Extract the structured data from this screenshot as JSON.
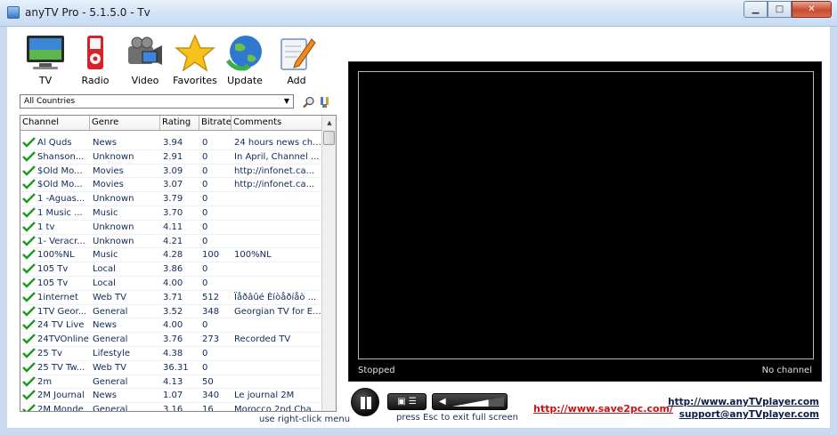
{
  "window": {
    "title": "anyTV Pro - 5.1.5.0 - Tv"
  },
  "toolbar": [
    {
      "id": "tv",
      "label": "TV",
      "icon": "tv-icon"
    },
    {
      "id": "radio",
      "label": "Radio",
      "icon": "radio-icon"
    },
    {
      "id": "video",
      "label": "Video",
      "icon": "video-camera-icon"
    },
    {
      "id": "favorites",
      "label": "Favorites",
      "icon": "star-icon"
    },
    {
      "id": "update",
      "label": "Update",
      "icon": "globe-update-icon"
    },
    {
      "id": "add",
      "label": "Add",
      "icon": "add-edit-icon"
    }
  ],
  "country_filter": {
    "selected": "All Countries"
  },
  "table": {
    "columns": [
      "Channel",
      "Genre",
      "Rating",
      "Bitrate",
      "Comments"
    ],
    "rows": [
      [
        "Al Quds",
        "News",
        "3.94",
        "0",
        "24 hours news ch..."
      ],
      [
        "Shanson...",
        "Unknown",
        "2.91",
        "0",
        "In April, Channel ..."
      ],
      [
        "$Old Mo...",
        "Movies",
        "3.09",
        "0",
        "http://infonet.ca..."
      ],
      [
        "$Old Mo...",
        "Movies",
        "3.07",
        "0",
        "http://infonet.ca..."
      ],
      [
        "1 -Aguas...",
        "Unknown",
        "3.79",
        "0",
        ""
      ],
      [
        "1 Music ...",
        "Music",
        "3.70",
        "0",
        ""
      ],
      [
        "1 tv",
        "Unknown",
        "4.11",
        "0",
        ""
      ],
      [
        "1- Veracr...",
        "Unknown",
        "4.21",
        "0",
        ""
      ],
      [
        "100%NL",
        "Music",
        "4.28",
        "100",
        "100%NL"
      ],
      [
        "105 Tv",
        "Local",
        "3.86",
        "0",
        ""
      ],
      [
        "105 Tv",
        "Local",
        "4.00",
        "0",
        ""
      ],
      [
        "1internet",
        "Web TV",
        "3.71",
        "512",
        "Ïåðâûé Èíòåðíåò ..."
      ],
      [
        "1TV Geor...",
        "General",
        "3.52",
        "348",
        "Georgian TV for E..."
      ],
      [
        "24 TV Live",
        "News",
        "4.00",
        "0",
        ""
      ],
      [
        "24TVOnline",
        "General",
        "3.76",
        "273",
        "Recorded TV"
      ],
      [
        "25 Tv",
        "Lifestyle",
        "4.38",
        "0",
        ""
      ],
      [
        "25 TV Tw...",
        "Web TV",
        "36.31",
        "0",
        ""
      ],
      [
        "2m",
        "General",
        "4.13",
        "50",
        ""
      ],
      [
        "2M Journal",
        "News",
        "1.07",
        "340",
        "Le journal 2M"
      ],
      [
        "2M Monde",
        "General",
        "3.16",
        "16",
        "Morocco 2nd Cha..."
      ]
    ]
  },
  "table_hint": "use right-click menu",
  "player": {
    "status": "Stopped",
    "channel": "No channel"
  },
  "controls": {
    "esc_hint": "press Esc to exit full screen",
    "volume_level": 0.7
  },
  "links": {
    "save2pc": "http://www.save2pc.com/",
    "anytv": "http://www.anyTVplayer.com",
    "support": "support@anyTVplayer.com"
  }
}
